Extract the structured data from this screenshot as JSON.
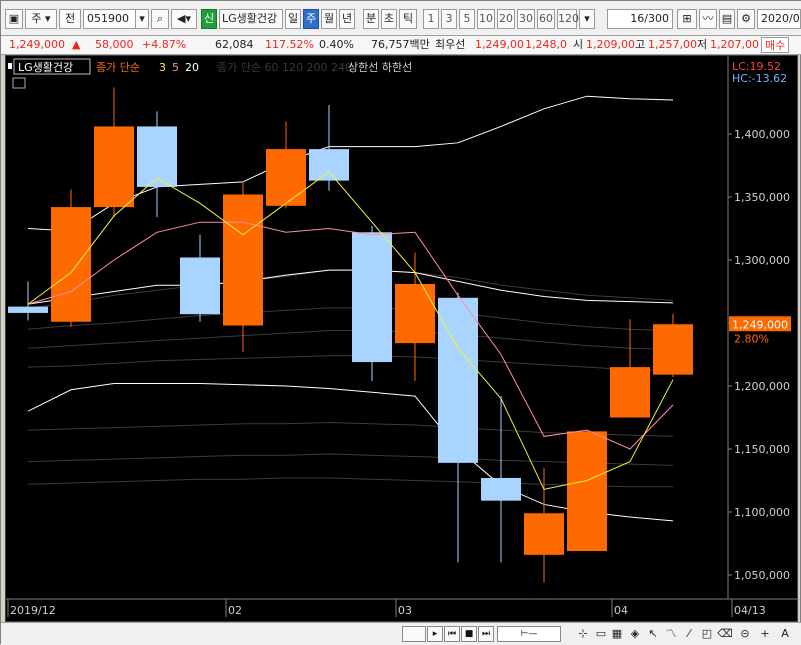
{
  "toolbar": {
    "type_label": "주",
    "prev_label": "전",
    "code": "051900",
    "badge": "신",
    "stock_name": "LG생활건강",
    "periods": [
      "일",
      "주",
      "월",
      "년",
      "분",
      "초",
      "틱"
    ],
    "selected_period": "주",
    "intervals": [
      "1",
      "3",
      "5",
      "10",
      "20",
      "30",
      "60",
      "120"
    ],
    "count": "16/300",
    "date": "2020/0"
  },
  "quote": {
    "price": "1,249,000",
    "up_mark": "▲",
    "change": "58,000",
    "change_pct": "+4.87%",
    "volume": "62,084",
    "vol_ratio": "117.52%",
    "turnover": "0.40%",
    "amount": "76,757백만",
    "pref": "최우선",
    "ask": "1,249,00",
    "bid": "1,248,0",
    "open_label": "시",
    "open": "1,209,00",
    "high_label": "고",
    "high": "1,257,00",
    "low_label": "저",
    "low": "1,207,00",
    "buy_btn": "매수"
  },
  "legend": {
    "name": "LG생활건강",
    "ma_label": "종가 단순",
    "ma_periods": [
      "3",
      "5",
      "20"
    ],
    "ma_dim": "종가 단순 60 120 200 240",
    "limit_labels": "상한선 하한선"
  },
  "colors": {
    "up": "#ff6a00",
    "down": "#a8d4ff",
    "ma3": "#f2f238",
    "ma5": "#ff8ca8",
    "ma20": "#ffffff",
    "lc": "#ff4040",
    "hc": "#7ab0ff"
  },
  "chart_data": {
    "type": "candlestick",
    "x_labels": [
      "2019/12",
      "02",
      "03",
      "04",
      "04/13"
    ],
    "y_ticks": [
      "1,400,000",
      "1,350,000",
      "1,300,000",
      "1,250,000",
      "1,200,000",
      "1,150,000",
      "1,100,000",
      "1,050,000"
    ],
    "y_values": [
      1400000,
      1350000,
      1300000,
      1250000,
      1200000,
      1150000,
      1100000,
      1050000
    ],
    "ylim": [
      1020000,
      1440000
    ],
    "candles": [
      {
        "o": 1263000,
        "h": 1283000,
        "l": 1252000,
        "c": 1258000
      },
      {
        "o": 1251000,
        "h": 1356000,
        "l": 1247000,
        "c": 1342000
      },
      {
        "o": 1342000,
        "h": 1437000,
        "l": 1334000,
        "c": 1406000
      },
      {
        "o": 1406000,
        "h": 1418000,
        "l": 1334000,
        "c": 1358000
      },
      {
        "o": 1302000,
        "h": 1320000,
        "l": 1251000,
        "c": 1257000
      },
      {
        "o": 1248000,
        "h": 1362000,
        "l": 1227000,
        "c": 1352000
      },
      {
        "o": 1343000,
        "h": 1410000,
        "l": 1341000,
        "c": 1388000
      },
      {
        "o": 1388000,
        "h": 1423000,
        "l": 1355000,
        "c": 1363000
      },
      {
        "o": 1322000,
        "h": 1327000,
        "l": 1204000,
        "c": 1219000
      },
      {
        "o": 1234000,
        "h": 1306000,
        "l": 1204000,
        "c": 1281000
      },
      {
        "o": 1270000,
        "h": 1274000,
        "l": 1060000,
        "c": 1139000
      },
      {
        "o": 1127000,
        "h": 1192000,
        "l": 1060000,
        "c": 1109000
      },
      {
        "o": 1066000,
        "h": 1135000,
        "l": 1044000,
        "c": 1099000
      },
      {
        "o": 1069000,
        "h": 1165000,
        "l": 1069000,
        "c": 1164000
      },
      {
        "o": 1175000,
        "h": 1253000,
        "l": 1175000,
        "c": 1215000
      },
      {
        "o": 1209000,
        "h": 1257000,
        "l": 1207000,
        "c": 1249000
      }
    ],
    "ma3": [
      1265000,
      1290000,
      1335000,
      1365000,
      1345000,
      1320000,
      1345000,
      1370000,
      1330000,
      1290000,
      1230000,
      1190000,
      1118000,
      1125000,
      1140000,
      1205000
    ],
    "ma5": [
      1265000,
      1275000,
      1300000,
      1322000,
      1330000,
      1330000,
      1322000,
      1325000,
      1320000,
      1322000,
      1272000,
      1225000,
      1160000,
      1165000,
      1150000,
      1185000
    ],
    "ma20_upper": [
      1325000,
      1323000,
      1345000,
      1358000,
      1360000,
      1362000,
      1378000,
      1390000,
      1390000,
      1390000,
      1393000,
      1406000,
      1420000,
      1430000,
      1428000,
      1427000
    ],
    "ma20": [
      1265000,
      1270000,
      1275000,
      1280000,
      1280000,
      1283000,
      1288000,
      1292000,
      1292000,
      1290000,
      1283000,
      1276000,
      1271000,
      1268000,
      1267000,
      1266000
    ],
    "ma20_lower": [
      1180000,
      1197000,
      1202000,
      1202000,
      1202000,
      1201000,
      1200000,
      1198000,
      1195000,
      1192000,
      1150000,
      1121000,
      1106000,
      1100000,
      1096000,
      1093000
    ],
    "current_price": "1,249,000",
    "current_pct": "2.80%",
    "lc_label": "LC:19.52",
    "hc_label": "HC:-13.62"
  }
}
